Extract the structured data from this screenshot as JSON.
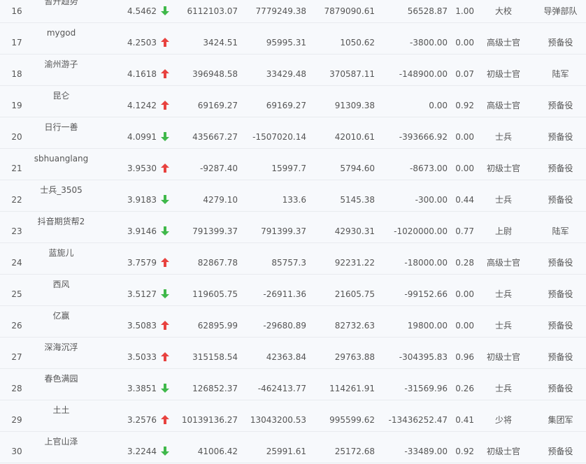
{
  "colors": {
    "up": "#e8423f",
    "down": "#3fb84a",
    "text": "#555555",
    "border": "#e8ebef",
    "background": "#f7f9fc"
  },
  "rows": [
    {
      "rank": "16",
      "name": "暂升趋势",
      "score": "4.5462",
      "trend": "down",
      "v1": "6112103.07",
      "v2": "7779249.38",
      "v3": "7879090.61",
      "v4": "56528.87",
      "v5": "1.00",
      "title": "大校",
      "unit": "导弹部队"
    },
    {
      "rank": "17",
      "name": "mygod",
      "score": "4.2503",
      "trend": "up",
      "v1": "3424.51",
      "v2": "95995.31",
      "v3": "1050.62",
      "v4": "-3800.00",
      "v5": "0.00",
      "title": "高级士官",
      "unit": "预备役"
    },
    {
      "rank": "18",
      "name": "渝州游子",
      "score": "4.1618",
      "trend": "up",
      "v1": "396948.58",
      "v2": "33429.48",
      "v3": "370587.11",
      "v4": "-148900.00",
      "v5": "0.07",
      "title": "初级士官",
      "unit": "陆军"
    },
    {
      "rank": "19",
      "name": "昆仑",
      "score": "4.1242",
      "trend": "up",
      "v1": "69169.27",
      "v2": "69169.27",
      "v3": "91309.38",
      "v4": "0.00",
      "v5": "0.92",
      "title": "高级士官",
      "unit": "预备役"
    },
    {
      "rank": "20",
      "name": "日行一善",
      "score": "4.0991",
      "trend": "down",
      "v1": "435667.27",
      "v2": "-1507020.14",
      "v3": "42010.61",
      "v4": "-393666.92",
      "v5": "0.00",
      "title": "士兵",
      "unit": "预备役"
    },
    {
      "rank": "21",
      "name": "sbhuanglang",
      "score": "3.9530",
      "trend": "up",
      "v1": "-9287.40",
      "v2": "15997.7",
      "v3": "5794.60",
      "v4": "-8673.00",
      "v5": "0.00",
      "title": "初级士官",
      "unit": "预备役"
    },
    {
      "rank": "22",
      "name": "士兵_3505",
      "score": "3.9183",
      "trend": "down",
      "v1": "4279.10",
      "v2": "133.6",
      "v3": "5145.38",
      "v4": "-300.00",
      "v5": "0.44",
      "title": "士兵",
      "unit": "预备役"
    },
    {
      "rank": "23",
      "name": "抖音期货帮2",
      "score": "3.9146",
      "trend": "down",
      "v1": "791399.37",
      "v2": "791399.37",
      "v3": "42930.31",
      "v4": "-1020000.00",
      "v5": "0.77",
      "title": "上尉",
      "unit": "陆军"
    },
    {
      "rank": "24",
      "name": "蓝旎儿",
      "score": "3.7579",
      "trend": "up",
      "v1": "82867.78",
      "v2": "85757.3",
      "v3": "92231.22",
      "v4": "-18000.00",
      "v5": "0.28",
      "title": "高级士官",
      "unit": "预备役"
    },
    {
      "rank": "25",
      "name": "西风",
      "score": "3.5127",
      "trend": "down",
      "v1": "119605.75",
      "v2": "-26911.36",
      "v3": "21605.75",
      "v4": "-99152.66",
      "v5": "0.00",
      "title": "士兵",
      "unit": "预备役"
    },
    {
      "rank": "26",
      "name": "亿赢",
      "score": "3.5083",
      "trend": "up",
      "v1": "62895.99",
      "v2": "-29680.89",
      "v3": "82732.63",
      "v4": "19800.00",
      "v5": "0.00",
      "title": "士兵",
      "unit": "预备役"
    },
    {
      "rank": "27",
      "name": "深海沉浮",
      "score": "3.5033",
      "trend": "up",
      "v1": "315158.54",
      "v2": "42363.84",
      "v3": "29763.88",
      "v4": "-304395.83",
      "v5": "0.96",
      "title": "初级士官",
      "unit": "预备役"
    },
    {
      "rank": "28",
      "name": "春色满园",
      "score": "3.3851",
      "trend": "down",
      "v1": "126852.37",
      "v2": "-462413.77",
      "v3": "114261.91",
      "v4": "-31569.96",
      "v5": "0.26",
      "title": "士兵",
      "unit": "预备役"
    },
    {
      "rank": "29",
      "name": "土土",
      "score": "3.2576",
      "trend": "up",
      "v1": "10139136.27",
      "v2": "13043200.53",
      "v3": "995599.62",
      "v4": "-13436252.47",
      "v5": "0.41",
      "title": "少将",
      "unit": "集团军"
    },
    {
      "rank": "30",
      "name": "上官山泽",
      "score": "3.2244",
      "trend": "down",
      "v1": "41006.42",
      "v2": "25991.61",
      "v3": "25172.68",
      "v4": "-33489.00",
      "v5": "0.92",
      "title": "初级士官",
      "unit": "预备役"
    }
  ]
}
